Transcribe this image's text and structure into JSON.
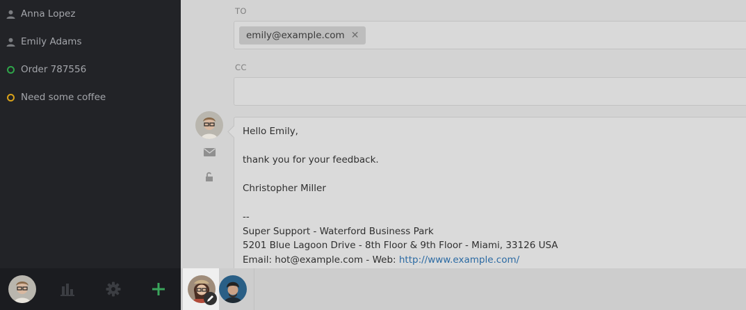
{
  "sidebar": {
    "items": [
      {
        "label": "Anna Lopez",
        "icon": "person-icon",
        "color": "#7a7c80"
      },
      {
        "label": "Emily Adams",
        "icon": "person-icon",
        "color": "#7a7c80"
      },
      {
        "label": "Order 787556",
        "icon": "status-ring-green-icon",
        "color": "#2fa54a"
      },
      {
        "label": "Need some coffee",
        "icon": "status-ring-yellow-icon",
        "color": "#d9a21a"
      }
    ],
    "bottom": {
      "avatar": "user-avatar",
      "stats_icon": "bar-chart-icon",
      "settings_icon": "gear-icon",
      "add_icon": "plus-icon",
      "add_color": "#3aa55b"
    }
  },
  "compose": {
    "to_label": "TO",
    "to_token": "emily@example.com",
    "to_token_remove": "✕",
    "cc_label": "CC",
    "body_lines": [
      "Hello Emily,",
      "",
      "thank you for your feedback.",
      "",
      "Christopher Miller",
      "",
      "--",
      "Super Support - Waterford Business Park",
      "5201 Blue Lagoon Drive - 8th Floor & 9th Floor - Miami, 33126 USA"
    ],
    "email_line_prefix": "Email: hot@example.com - Web: ",
    "web_link": "http://www.example.com/"
  },
  "colors": {
    "sidebar_bg": "#222327",
    "main_bg": "#d3d3d3",
    "link": "#2b6aa3"
  }
}
